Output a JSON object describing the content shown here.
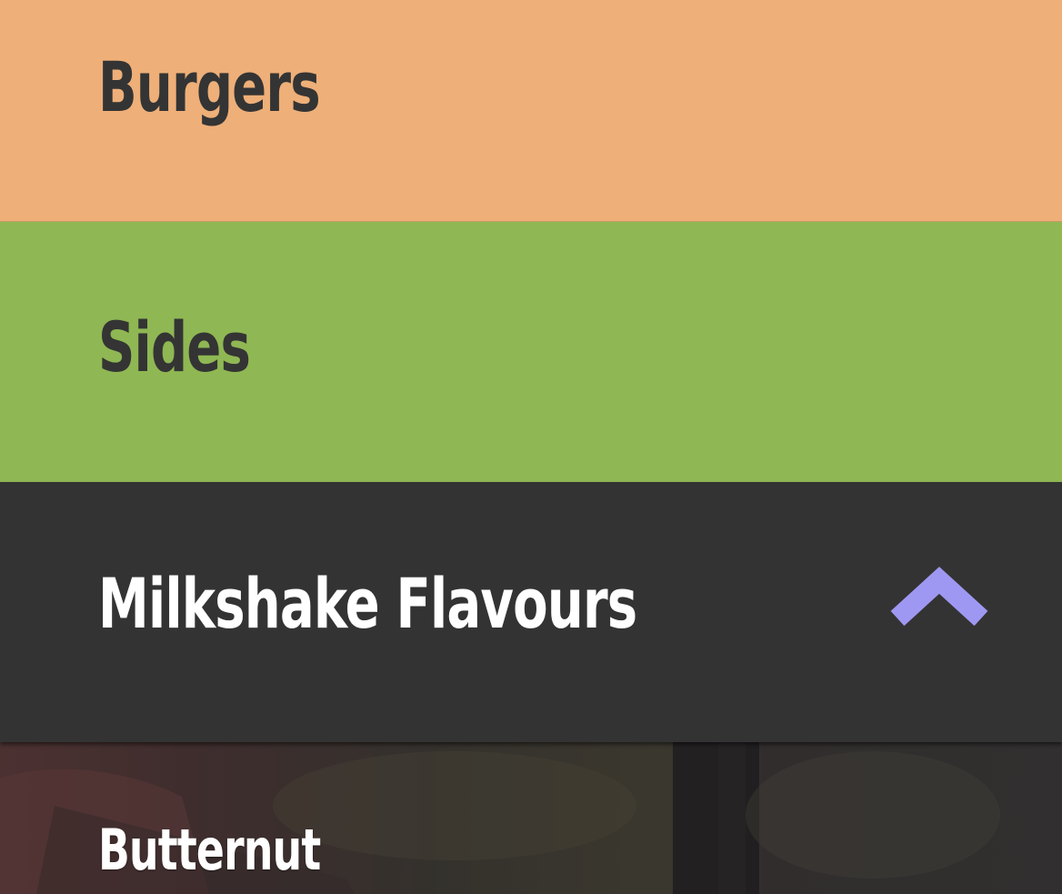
{
  "menu": {
    "categories": [
      {
        "label": "Burgers",
        "color": "#eeaf78",
        "expanded": false
      },
      {
        "label": "Sides",
        "color": "#8fb753",
        "expanded": false
      },
      {
        "label": "Milkshake Flavours",
        "color": "#333333",
        "expanded": true,
        "toggle_icon": "chevron-up-icon",
        "icon_color": "#9f98f2"
      }
    ],
    "flavours": [
      {
        "label": "Butternut"
      }
    ]
  }
}
